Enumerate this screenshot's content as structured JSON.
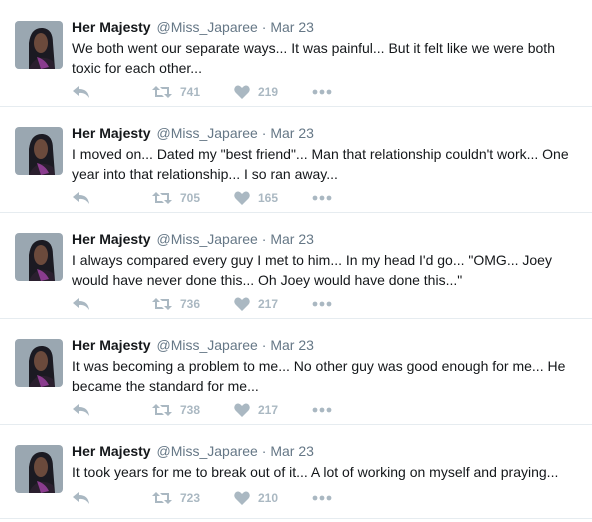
{
  "tweets": [
    {
      "name": "Her Majesty",
      "handle": "@Miss_Japaree",
      "separator": "·",
      "date": "Mar 23",
      "text": "We both went our separate ways... It was painful... But it felt like we were both toxic for each other...",
      "retweets": "741",
      "likes": "219"
    },
    {
      "name": "Her Majesty",
      "handle": "@Miss_Japaree",
      "separator": "·",
      "date": "Mar 23",
      "text": "I moved on... Dated my \"best friend\"... Man that relationship couldn't work... One year into that relationship... I so ran away...",
      "retweets": "705",
      "likes": "165"
    },
    {
      "name": "Her Majesty",
      "handle": "@Miss_Japaree",
      "separator": "·",
      "date": "Mar 23",
      "text": "I always compared every guy I met to him... In my head I'd go... \"OMG... Joey would have never done this... Oh Joey would have done this...\"",
      "retweets": "736",
      "likes": "217"
    },
    {
      "name": "Her Majesty",
      "handle": "@Miss_Japaree",
      "separator": "·",
      "date": "Mar 23",
      "text": "It was becoming a problem to me... No other guy was good enough for me... He became the standard for me...",
      "retweets": "738",
      "likes": "217"
    },
    {
      "name": "Her Majesty",
      "handle": "@Miss_Japaree",
      "separator": "·",
      "date": "Mar 23",
      "text": "It took years for me to break out of it... A lot of working on myself and praying...",
      "retweets": "723",
      "likes": "210"
    }
  ],
  "icons": {
    "reply": "reply-icon",
    "retweet": "retweet-icon",
    "like": "heart-icon",
    "more": "more-icon"
  },
  "colors": {
    "name": "#14171a",
    "meta": "#657786",
    "action": "#aab8c2",
    "divider": "#e6ecf0"
  }
}
